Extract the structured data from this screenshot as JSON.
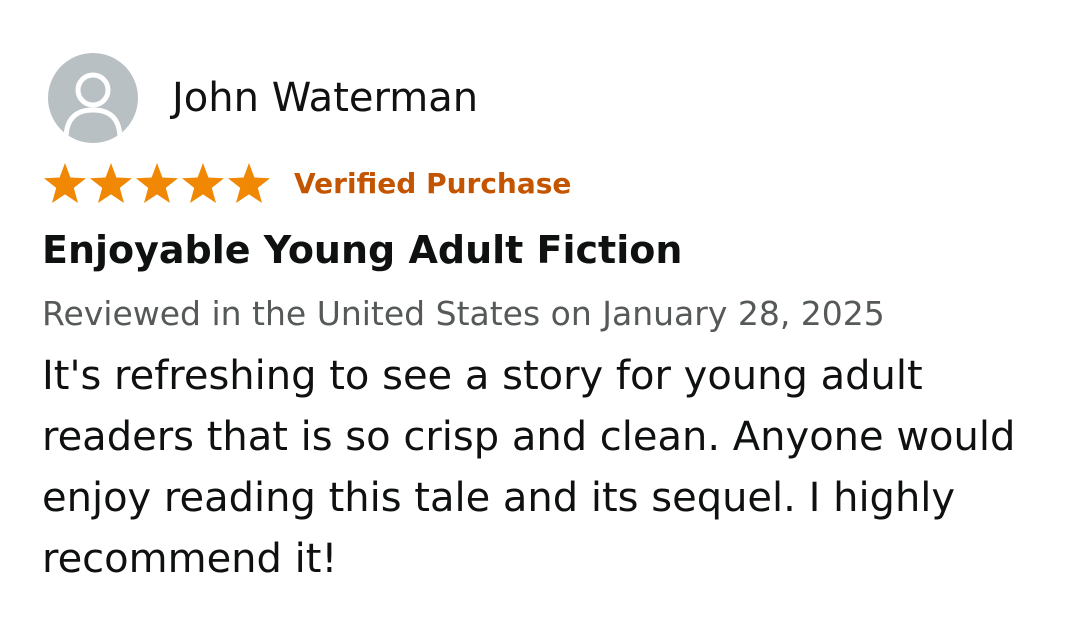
{
  "review": {
    "reviewer": {
      "name": "John Waterman",
      "avatar_icon": "default-user-avatar-icon"
    },
    "rating": {
      "stars": 5,
      "max_stars": 5,
      "star_color": "#f08804",
      "icon": "star-icon"
    },
    "badge": {
      "label": "Verified Purchase",
      "color": "#c45500"
    },
    "title": "Enjoyable Young Adult Fiction",
    "date_line": "Reviewed in the United States on January 28, 2025",
    "body": "It's refreshing to see a story for young adult readers that is so crisp and clean. Anyone would enjoy reading this tale and its sequel. I highly recommend it!"
  },
  "colors": {
    "avatar_background": "#b9c0c4",
    "avatar_figure": "#ffffff",
    "text_primary": "#0f1111",
    "text_secondary": "#565959"
  }
}
